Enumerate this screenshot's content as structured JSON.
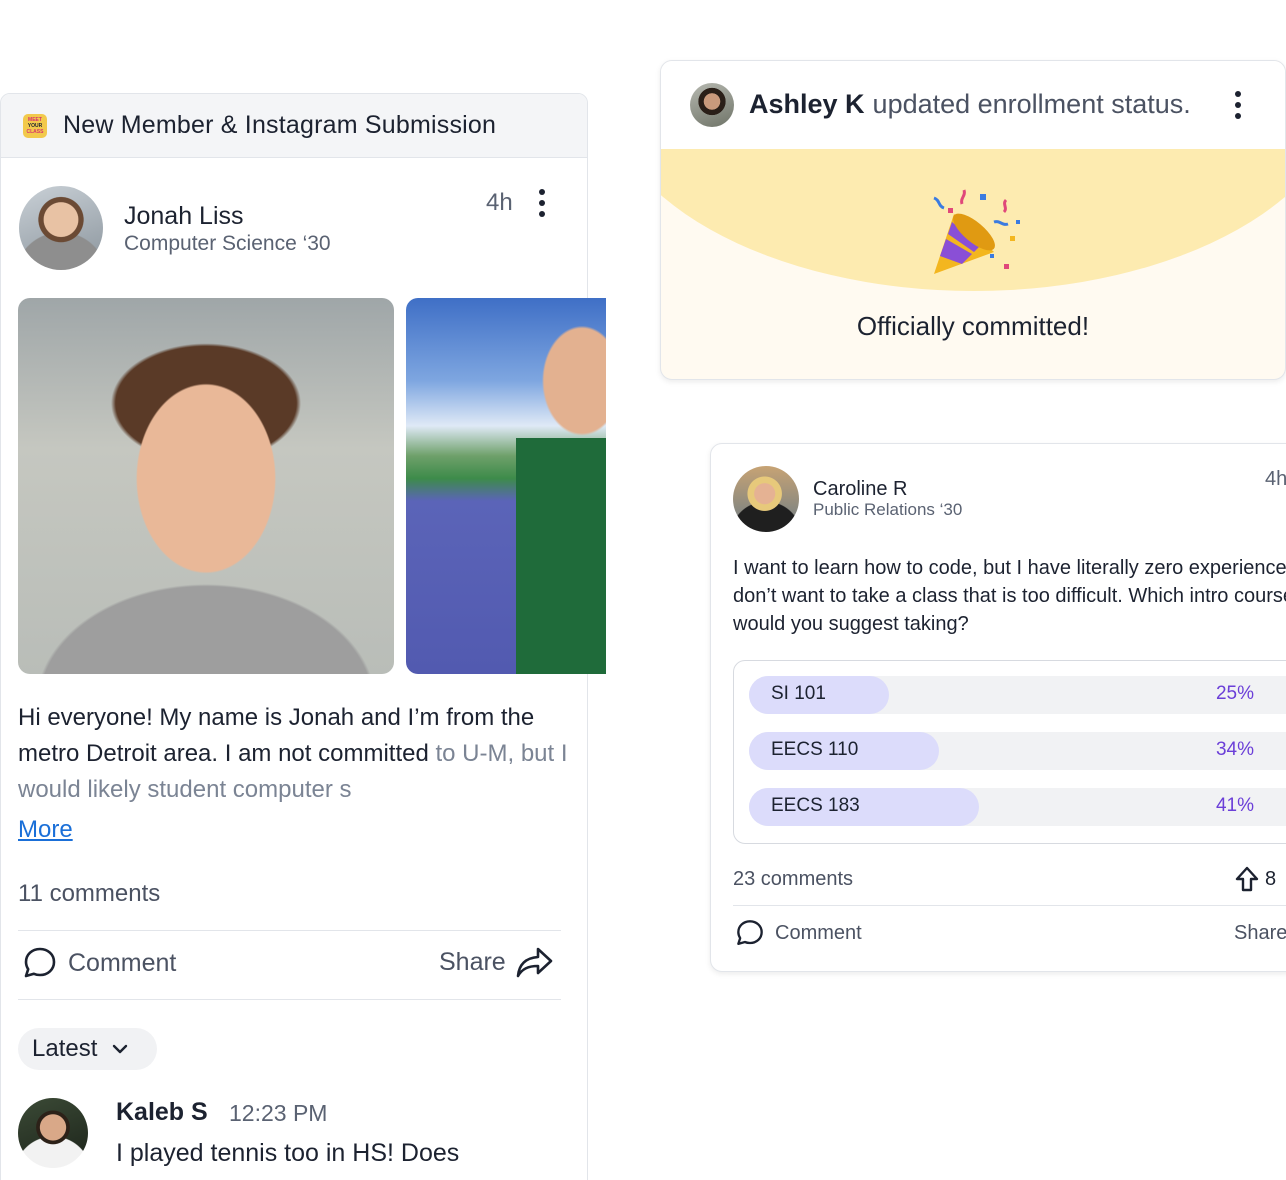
{
  "left_card": {
    "header_logo_lines": [
      "MEET",
      "YOUR",
      "CLASS"
    ],
    "header_title": "New Member & Instagram Submission",
    "author": {
      "name": "Jonah Liss",
      "subtitle": "Computer Science ‘30",
      "time": "4h"
    },
    "body_text": "Hi everyone! My name is Jonah and I’m from the metro Detroit area. I am not committed",
    "body_text_faded": "to U-M, but I would likely student computer s",
    "more_label": "More",
    "comments_count": "11 comments",
    "comment_label": "Comment",
    "share_label": "Share",
    "sort_label": "Latest",
    "first_comment": {
      "name": "Kaleb S",
      "time": "12:23 PM",
      "text": "I played tennis too in HS! Does"
    }
  },
  "ashley_card": {
    "name": "Ashley K",
    "action": "updated enrollment status.",
    "message": "Officially committed!"
  },
  "caroline_card": {
    "name": "Caroline R",
    "subtitle": "Public Relations ‘30",
    "time": "4h",
    "question": "I want to learn how to code, but I have literally zero experience and don’t want to take a class that is too difficult. Which intro course would you suggest taking?",
    "poll": [
      {
        "label": "SI 101",
        "percent_text": "25%",
        "percent": 25
      },
      {
        "label": "EECS 110",
        "percent_text": "34%",
        "percent": 34
      },
      {
        "label": "EECS 183",
        "percent_text": "41%",
        "percent": 41
      }
    ],
    "comments_count": "23 comments",
    "upvotes": "8",
    "comment_label": "Comment",
    "share_label": "Share"
  },
  "colors": {
    "accent_purple": "#6b3fd8",
    "poll_fill": "#dcdcfb",
    "link_blue": "#1a6fd8",
    "banner_yellow": "#fdebb0"
  }
}
